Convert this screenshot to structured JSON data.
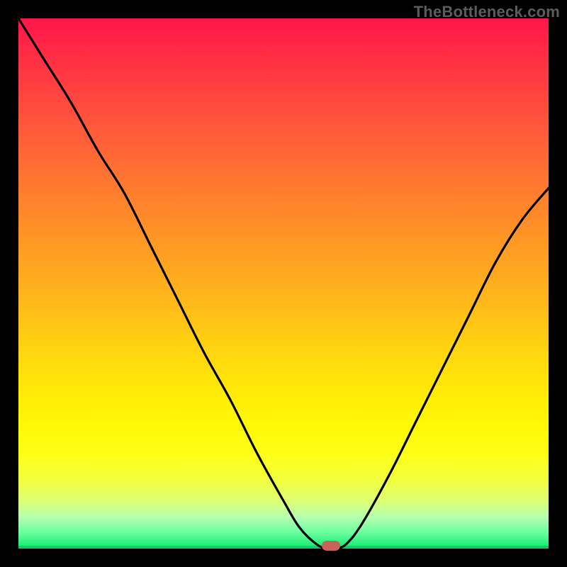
{
  "watermark": "TheBottleneck.com",
  "colors": {
    "background": "#000000",
    "curve_stroke": "#000000",
    "marker": "#c6645b",
    "baseline": "#0fcf64"
  },
  "chart_data": {
    "type": "line",
    "title": "",
    "xlabel": "",
    "ylabel": "",
    "xlim": [
      0,
      100
    ],
    "ylim": [
      0,
      100
    ],
    "x": [
      0,
      5,
      10,
      15,
      20,
      25,
      30,
      35,
      40,
      45,
      50,
      53,
      56,
      58,
      60,
      62,
      65,
      70,
      75,
      80,
      85,
      90,
      95,
      100
    ],
    "values": [
      100,
      92,
      84,
      75,
      67,
      57,
      47,
      37,
      28,
      18,
      9,
      4,
      1,
      0,
      0,
      1,
      5,
      14,
      24,
      34,
      44,
      54,
      62,
      68
    ],
    "marker": {
      "x": 59,
      "y": 0
    },
    "gradient_stops": [
      {
        "y": 100,
        "color": "#ff1649"
      },
      {
        "y": 60,
        "color": "#ff9226"
      },
      {
        "y": 30,
        "color": "#ffe808"
      },
      {
        "y": 10,
        "color": "#dcff73"
      },
      {
        "y": 0,
        "color": "#16e86f"
      }
    ]
  }
}
